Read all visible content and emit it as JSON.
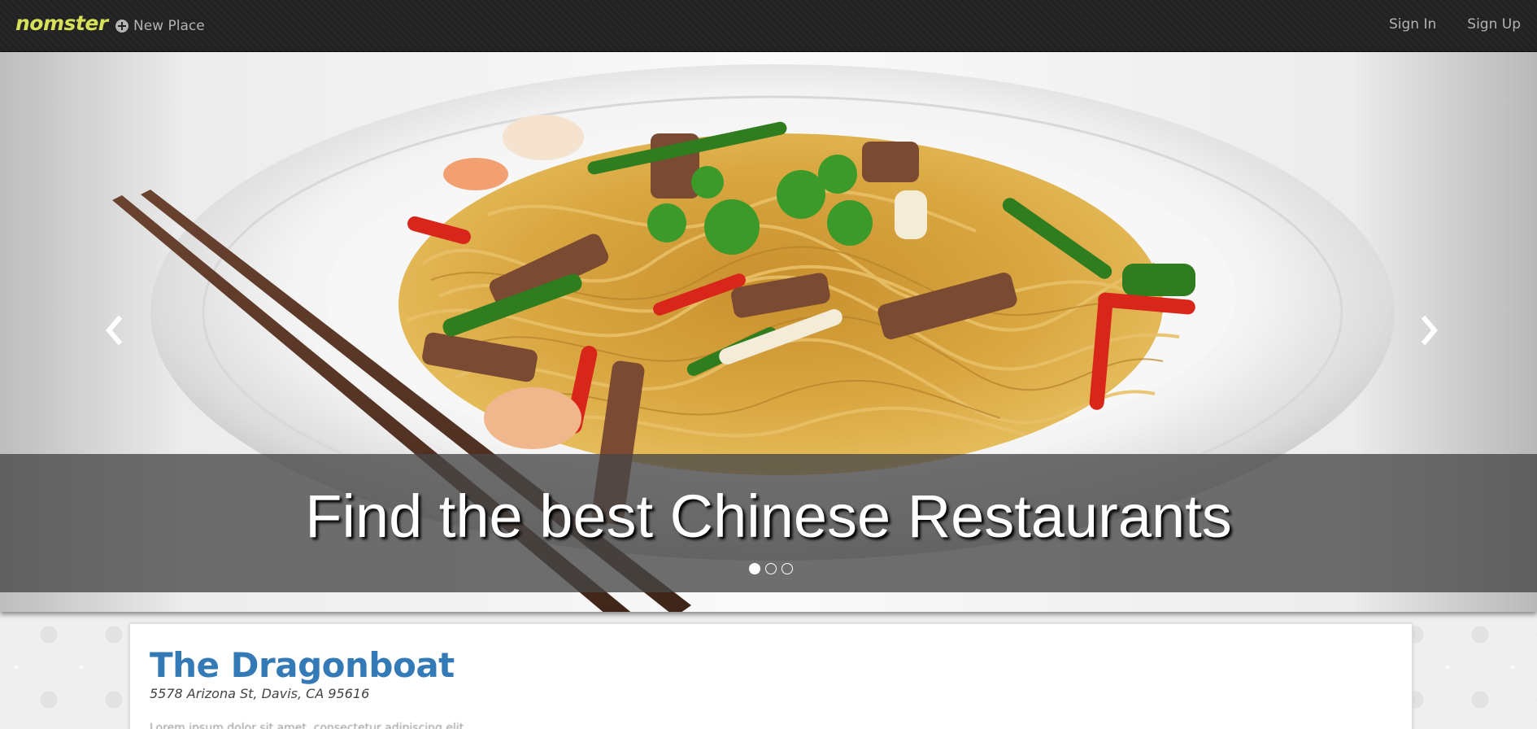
{
  "navbar": {
    "brand": "nomster",
    "new_place_label": "New Place",
    "new_place_icon": "plus-circle-icon",
    "sign_in_label": "Sign In",
    "sign_up_label": "Sign Up"
  },
  "carousel": {
    "caption": "Find the best Chinese Restaurants",
    "slide_count": 3,
    "active_slide": 1,
    "prev_icon": "chevron-left-icon",
    "next_icon": "chevron-right-icon"
  },
  "place": {
    "name": "The Dragonboat",
    "address": "5578 Arizona St, Davis, CA 95616",
    "description": "Lorem ipsum dolor sit amet, consectetur adipiscing elit"
  },
  "colors": {
    "navbar_bg": "#222222",
    "brand": "#d6e15a",
    "link": "#337ab7"
  }
}
